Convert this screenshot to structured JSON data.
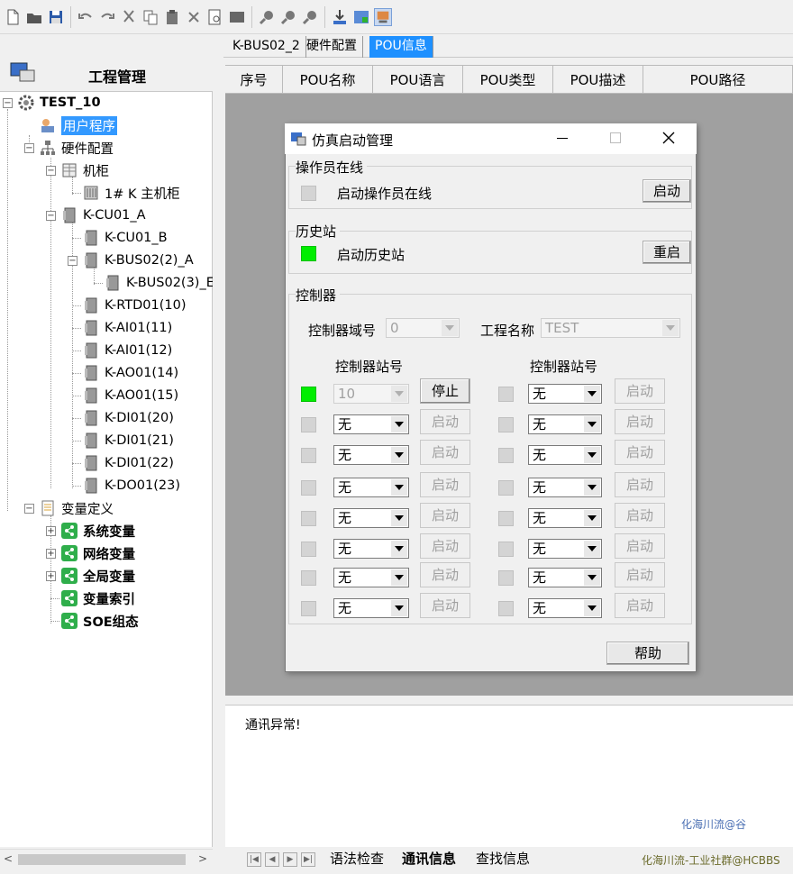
{
  "toolbar": {
    "icons": [
      "new-file-icon",
      "open-folder-icon",
      "save-icon",
      "undo-icon",
      "redo-icon",
      "cut-icon",
      "copy-icon",
      "paste-icon",
      "delete-icon",
      "print-preview-icon",
      "window-icon",
      "search-icon",
      "find-prev-icon",
      "find-next-icon",
      "download-icon",
      "compile-icon",
      "simulate-icon"
    ]
  },
  "left_panel": {
    "title": "工程管理",
    "tree": {
      "root": "TEST_10",
      "user_program": "用户程序",
      "hardware": "硬件配置",
      "cabinet": "机柜",
      "main_cabinet": "1# K 主机柜",
      "cu01a": "K-CU01_A",
      "cu01b": "K-CU01_B",
      "bus02_2": "K-BUS02(2)_A",
      "bus02_3": "K-BUS02(3)_E",
      "rtd01": "K-RTD01(10)",
      "ai11": "K-AI01(11)",
      "ai12": "K-AI01(12)",
      "ao14": "K-AO01(14)",
      "ao15": "K-AO01(15)",
      "di20": "K-DI01(20)",
      "di21": "K-DI01(21)",
      "di22": "K-DI01(22)",
      "do23": "K-DO01(23)",
      "vardef": "变量定义",
      "sysvar": "系统变量",
      "netvar": "网络变量",
      "globalvar": "全局变量",
      "varindex": "变量索引",
      "soe": "SOE组态"
    }
  },
  "tabs": [
    "K-BUS02_2",
    "硬件配置",
    "POU信息"
  ],
  "grid_headers": [
    "序号",
    "POU名称",
    "POU语言",
    "POU类型",
    "POU描述",
    "POU路径"
  ],
  "dialog": {
    "title": "仿真启动管理",
    "operator_group": "操作员在线",
    "operator_label": "启动操作员在线",
    "operator_button": "启动",
    "history_group": "历史站",
    "history_label": "启动历史站",
    "history_button": "重启",
    "controller_group": "控制器",
    "domain_label": "控制器域号",
    "domain_value": "0",
    "project_label": "工程名称",
    "project_value": "TEST",
    "station_header_left": "控制器站号",
    "station_header_right": "控制器站号",
    "left_rows": [
      {
        "value": "10",
        "button": "停止",
        "active": true
      },
      {
        "value": "无",
        "button": "启动",
        "active": false
      },
      {
        "value": "无",
        "button": "启动",
        "active": false
      },
      {
        "value": "无",
        "button": "启动",
        "active": false
      },
      {
        "value": "无",
        "button": "启动",
        "active": false
      },
      {
        "value": "无",
        "button": "启动",
        "active": false
      },
      {
        "value": "无",
        "button": "启动",
        "active": false
      },
      {
        "value": "无",
        "button": "启动",
        "active": false
      }
    ],
    "right_rows": [
      {
        "value": "无",
        "button": "启动"
      },
      {
        "value": "无",
        "button": "启动"
      },
      {
        "value": "无",
        "button": "启动"
      },
      {
        "value": "无",
        "button": "启动"
      },
      {
        "value": "无",
        "button": "启动"
      },
      {
        "value": "无",
        "button": "启动"
      },
      {
        "value": "无",
        "button": "启动"
      },
      {
        "value": "无",
        "button": "启动"
      }
    ],
    "help_button": "帮助",
    "colors": {
      "led_on": "#00ee00",
      "led_off": "#d4d4d4"
    }
  },
  "output": {
    "message": "通讯异常!",
    "watermark1": "化海川流@谷",
    "watermark2": "化海川流-工业社群@HCBBS"
  },
  "bottom_tabs": [
    "语法检查",
    "通讯信息",
    "查找信息"
  ]
}
